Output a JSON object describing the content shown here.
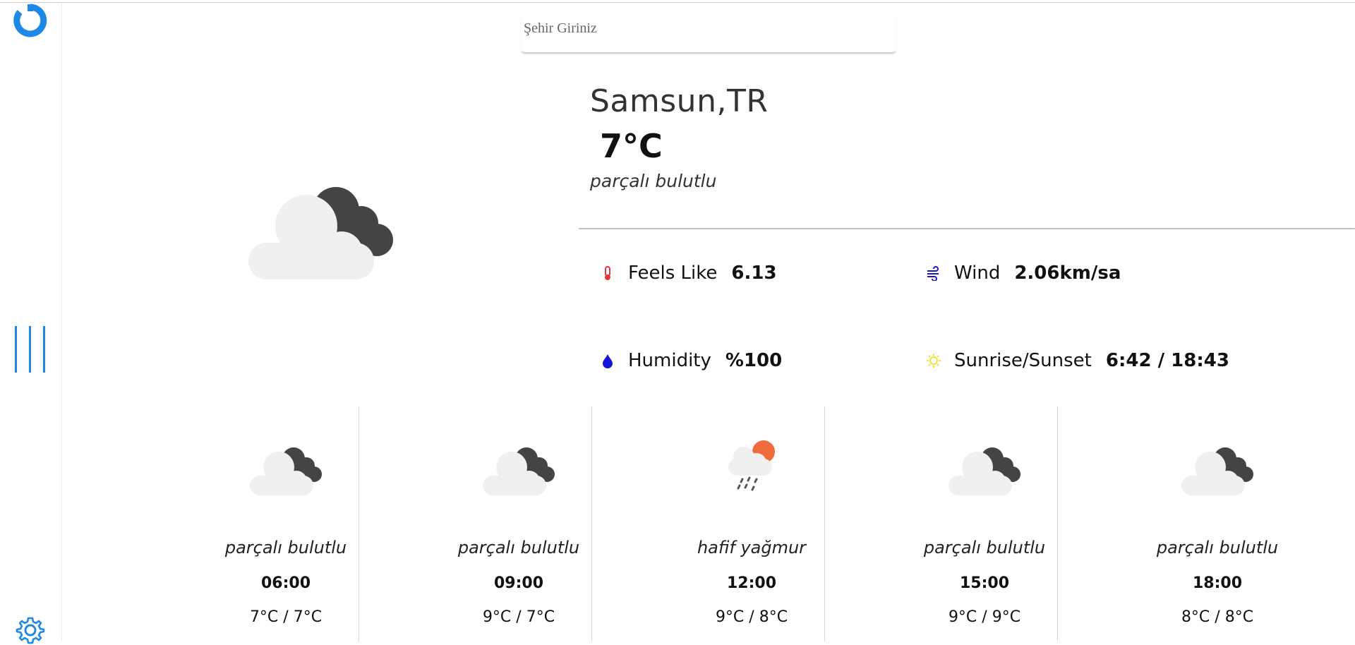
{
  "search": {
    "placeholder": "Şehir Giriniz"
  },
  "current": {
    "city": "Samsun,TR",
    "temperature": "7°C",
    "description": "parçalı bulutlu"
  },
  "stats": {
    "feels_like": {
      "label": "Feels Like",
      "value": "6.13"
    },
    "wind": {
      "label": "Wind",
      "value": "2.06km/sa"
    },
    "humidity": {
      "label": "Humidity",
      "value": "%100"
    },
    "sun": {
      "label": "Sunrise/Sunset",
      "value": "6:42 / 18:43"
    }
  },
  "forecast": [
    {
      "icon": "partly-cloudy-icon",
      "description": "parçalı bulutlu",
      "time": "06:00",
      "temps": "7°C / 7°C"
    },
    {
      "icon": "partly-cloudy-icon",
      "description": "parçalı bulutlu",
      "time": "09:00",
      "temps": "9°C / 7°C"
    },
    {
      "icon": "light-rain-icon",
      "description": "hafif yağmur",
      "time": "12:00",
      "temps": "9°C / 8°C"
    },
    {
      "icon": "partly-cloudy-icon",
      "description": "parçalı bulutlu",
      "time": "15:00",
      "temps": "9°C / 9°C"
    },
    {
      "icon": "partly-cloudy-icon",
      "description": "parçalı bulutlu",
      "time": "18:00",
      "temps": "8°C / 8°C"
    }
  ],
  "colors": {
    "accent": "#1e88e5",
    "thermometer": "#e53935",
    "wind": "#1a1acc",
    "humidity": "#1515d6",
    "sun": "#f2e233",
    "cloud_light": "#f0f0f0",
    "cloud_dark": "#444444",
    "sun_orange": "#ef6c3d"
  }
}
